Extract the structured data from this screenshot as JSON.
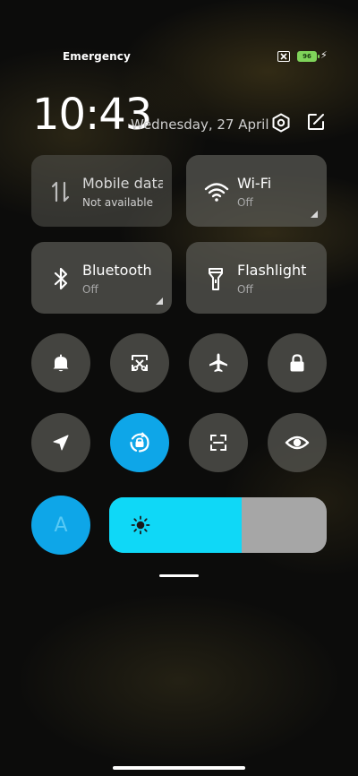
{
  "status_bar": {
    "carrier": "Emergency",
    "battery_level": "96",
    "battery_color": "#7fd35a"
  },
  "header": {
    "time": "10:43",
    "date": "Wednesday, 27 April",
    "settings_icon": "gear-icon",
    "edit_icon": "edit-icon"
  },
  "tiles": [
    {
      "name": "Mobile data",
      "label": "Mobile data",
      "status": "Not available",
      "icon": "mobile-data-icon",
      "active": false
    },
    {
      "name": "Wi-Fi",
      "label": "Wi-Fi",
      "status": "Off",
      "icon": "wifi-icon",
      "active": false
    },
    {
      "name": "Bluetooth",
      "label": "Bluetooth",
      "status": "Off",
      "icon": "bluetooth-icon",
      "active": false
    },
    {
      "name": "Flashlight",
      "label": "Flashlight",
      "status": "Off",
      "icon": "flashlight-icon",
      "active": false
    }
  ],
  "round_buttons": [
    {
      "icon": "bell-icon",
      "active": false
    },
    {
      "icon": "screenshot-icon",
      "active": false
    },
    {
      "icon": "airplane-icon",
      "active": false
    },
    {
      "icon": "lock-icon",
      "active": false
    },
    {
      "icon": "location-icon",
      "active": false
    },
    {
      "icon": "auto-rotate-icon",
      "active": true
    },
    {
      "icon": "scanner-icon",
      "active": false
    },
    {
      "icon": "eye-icon",
      "active": false
    }
  ],
  "brightness": {
    "auto_label": "A",
    "level_percent": 61,
    "icon": "sun-icon"
  },
  "colors": {
    "accent": "#0ea6e8",
    "brightness_fill": "#0fd8f7",
    "brightness_track": "#a6a6a6"
  }
}
